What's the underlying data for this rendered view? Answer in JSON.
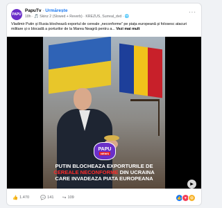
{
  "post": {
    "page_name": "PapuTv",
    "separator": "·",
    "follow_label": "Urmărește",
    "avatar_text": "PAPU",
    "meta": "18h · 🎵 Skinz 2 (Slowed + Reverb) · KREZUS, Surreal_dvd · 🌐",
    "menu": "···",
    "text": "Vladimir Putin și Rusia blochează exportul de cereale „neconforme” pe piața europeană și folosesc atacuri militare și o blocadă a porturilor de la Marea Neagră pentru a...",
    "more_label": "Vezi mai mult"
  },
  "media": {
    "logo_line1": "PAPU",
    "logo_line2": "NEWS",
    "headline_part1": "PUTIN BLOCHEAZA EXPORTURILE DE ",
    "headline_red": "CEREALE NECONFORME",
    "headline_part2": " DIN UCRAINA CARE INVADEAZA PIATA EUROPEANA",
    "next_icon": "▶"
  },
  "footer": {
    "likes": "1.470",
    "comments": "141",
    "shares": "109"
  },
  "icons": {
    "like": "like-icon",
    "comment": "comment-icon",
    "share": "share-icon",
    "next": "chevron-right-icon"
  },
  "colors": {
    "brand_purple": "#6a2fc8",
    "follow_blue": "#1877f2",
    "headline_red": "#ff2a2a",
    "ua_blue": "#2f63b6",
    "ua_yellow": "#e8c62a",
    "ro_blue": "#1d3f9a",
    "ro_yellow": "#f1c21b",
    "ro_red": "#c8202a"
  }
}
